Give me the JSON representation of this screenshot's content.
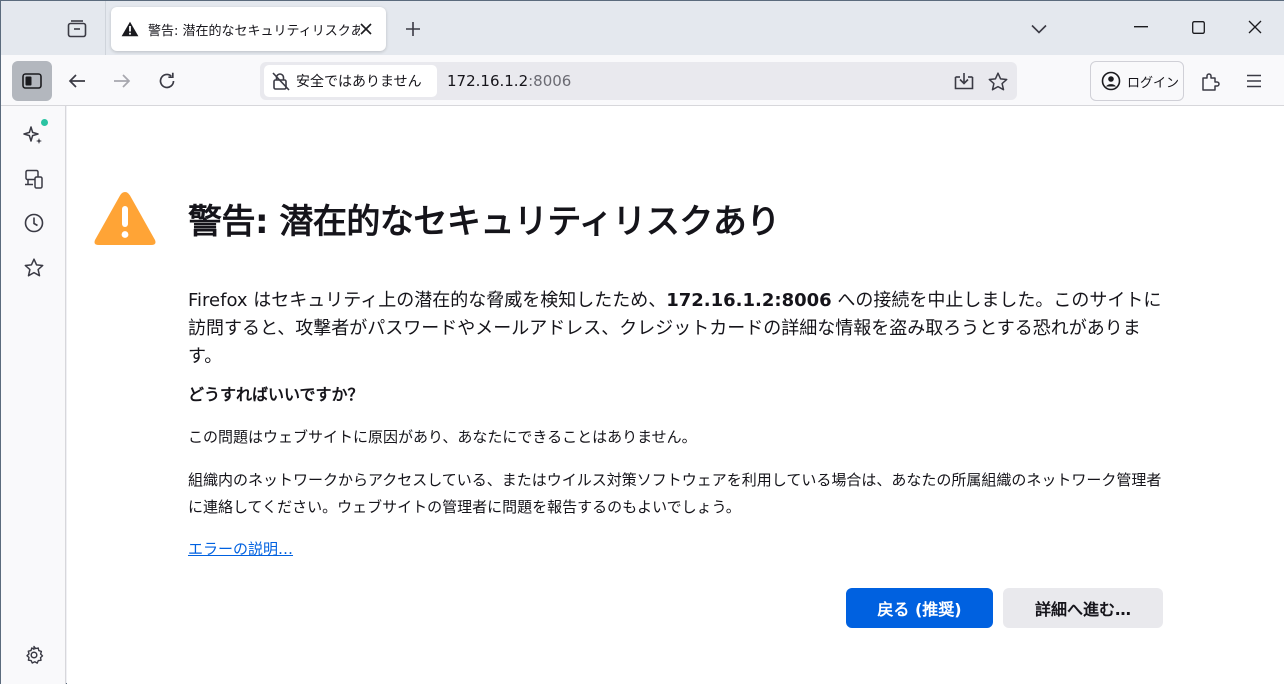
{
  "tab": {
    "title": "警告: 潜在的なセキュリティリスクあり",
    "icon": "warning-icon"
  },
  "window_controls": [
    "minimize",
    "maximize",
    "close"
  ],
  "toolbar": {
    "identity_label": "安全ではありません",
    "url_host": "172.16.1.2",
    "url_port": ":8006",
    "login_label": "ログイン"
  },
  "page": {
    "title": "警告: 潜在的なセキュリティリスクあり",
    "intro_before": "Firefox はセキュリティ上の潜在的な脅威を検知したため、",
    "intro_host": "172.16.1.2:8006",
    "intro_after": " への接続を中止しました。このサイトに訪問すると、攻撃者がパスワードやメールアドレス、クレジットカードの詳細な情報を盗み取ろうとする恐れがあります。",
    "question_heading": "どうすればいいですか？",
    "para1": "この問題はウェブサイトに原因があり、あなたにできることはありません。",
    "para2": "組織内のネットワークからアクセスしている、またはウイルス対策ソフトウェアを利用している場合は、あなたの所属組織のネットワーク管理者に連絡してください。ウェブサイトの管理者に問題を報告するのもよいでしょう。",
    "error_link": "エラーの説明…",
    "back_button": "戻る (推奨)",
    "advanced_button": "詳細へ進む…"
  },
  "colors": {
    "warning": "#ffa436",
    "primary_button": "#0061e0",
    "link": "#0061e0",
    "notification_dot": "#2ac3a2"
  }
}
